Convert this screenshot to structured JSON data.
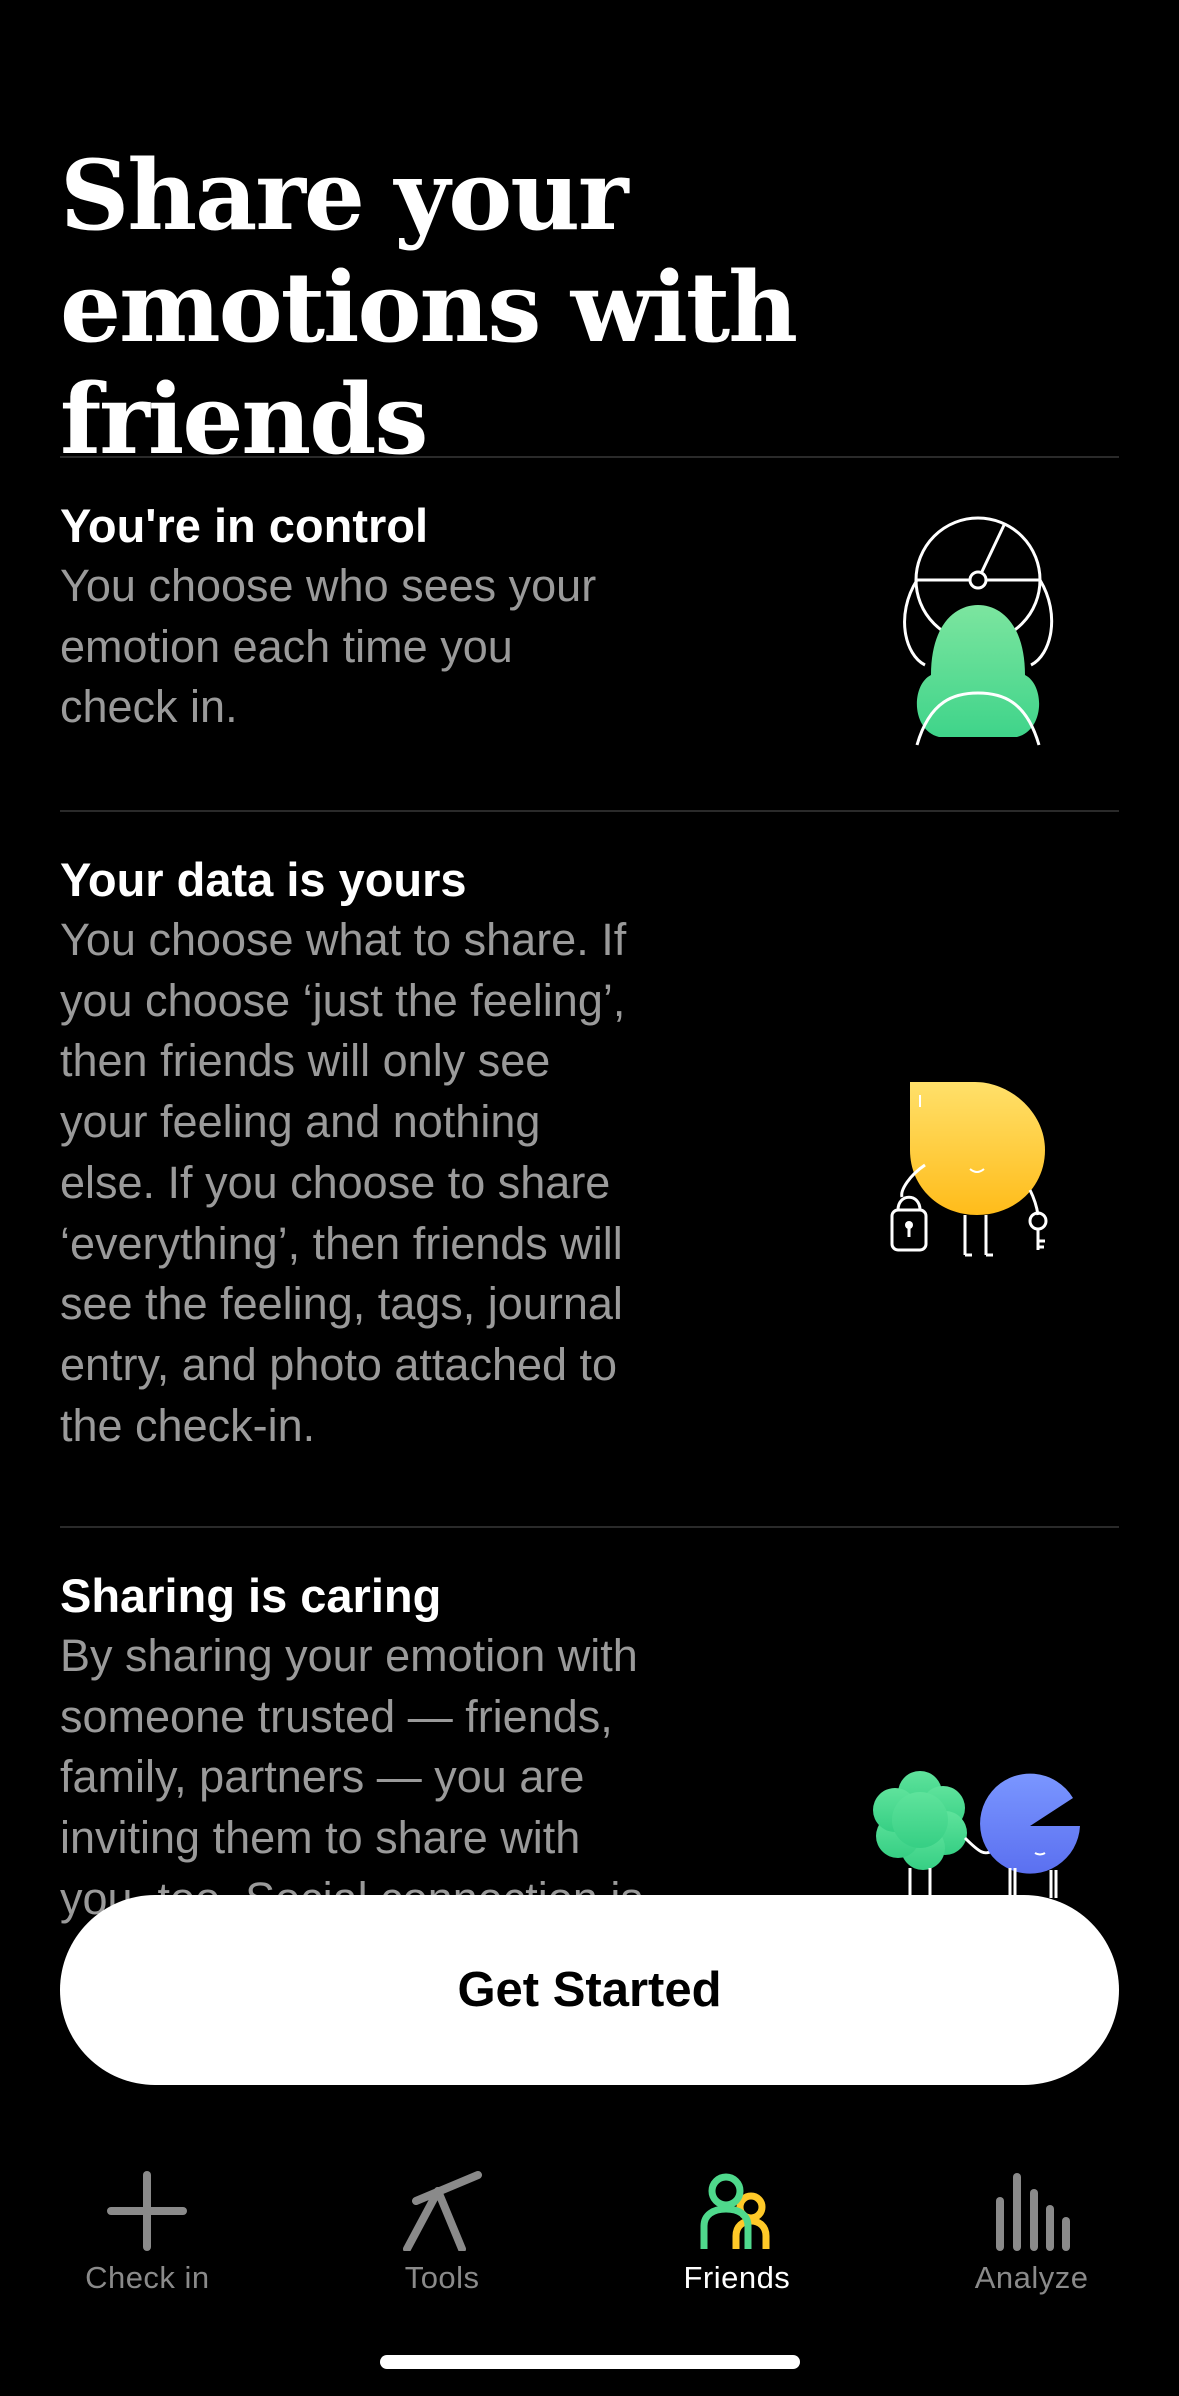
{
  "page": {
    "title": "Share your emotions with friends"
  },
  "features": [
    {
      "title": "You're in control",
      "body": "You choose who sees your\nemotion each time you\ncheck in.",
      "illustration_icon": "shield-character-icon"
    },
    {
      "title": "Your data is yours",
      "body": "You choose what to share. If\nyou choose ‘just the feeling’,\nthen friends will only see\nyour feeling and nothing\nelse. If you choose to share\n‘everything’, then friends will\nsee the feeling, tags, journal\nentry, and photo attached to\nthe check-in.",
      "illustration_icon": "lock-key-character-icon"
    },
    {
      "title": "Sharing is caring",
      "body": "By sharing your emotion with\nsomeone trusted — friends,\nfamily, partners — you are\ninviting them to share with\nyou, too. Social connection is",
      "illustration_icon": "friends-characters-icon"
    }
  ],
  "cta": {
    "label": "Get Started"
  },
  "tabbar": {
    "items": [
      {
        "label": "Check in",
        "icon": "plus-icon",
        "active": false
      },
      {
        "label": "Tools",
        "icon": "tools-icon",
        "active": false
      },
      {
        "label": "Friends",
        "icon": "friends-icon",
        "active": true
      },
      {
        "label": "Analyze",
        "icon": "bar-chart-icon",
        "active": false
      }
    ]
  },
  "colors": {
    "background": "#000000",
    "text_primary": "#ffffff",
    "text_secondary": "#9a9a9a",
    "green": "#4fd98c",
    "yellow": "#ffc928",
    "blue": "#6f86f7"
  }
}
